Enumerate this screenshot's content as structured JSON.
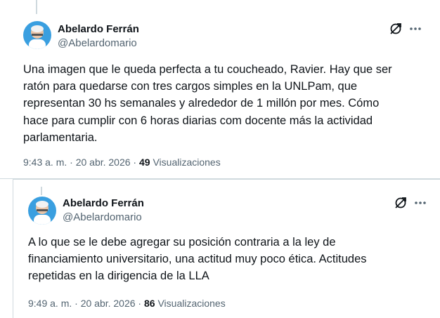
{
  "tweets": [
    {
      "author_name": "Abelardo Ferrán",
      "author_handle": "@Abelardomario",
      "text_lines": [
        "Una imagen que le queda perfecta a tu coucheado, Ravier. Hay que ser",
        "ratón para quedarse con tres cargos simples en la UNLPam, que",
        "representan 30 hs semanales y alrededor de 1 millón por mes. Cómo",
        "hace para cumplir con 6 horas diarias com docente más la actividad",
        "parlamentaria."
      ],
      "timestamp": "9:43 a. m. · 20 abr. 2026 · ",
      "views_count": "49",
      "views_label": " Visualizaciones"
    },
    {
      "author_name": "Abelardo Ferrán",
      "author_handle": "@Abelardomario",
      "text_lines": [
        "A lo que se le debe agregar su posición contraria a la ley de",
        "financiamiento universitario, una actitud muy poco ética. Actitudes",
        "repetidas en la dirigencia de la LLA"
      ],
      "timestamp": "9:49 a. m. · 20 abr. 2026 · ",
      "views_count": "86",
      "views_label": " Visualizaciones"
    }
  ],
  "icons": {
    "grok": "grok-icon",
    "more": "more-icon",
    "avatar": "avatar"
  },
  "colors": {
    "text_primary": "#0f1419",
    "text_secondary": "#536471",
    "border": "#cfd9de",
    "avatar_bg": "#1d9bf0"
  }
}
